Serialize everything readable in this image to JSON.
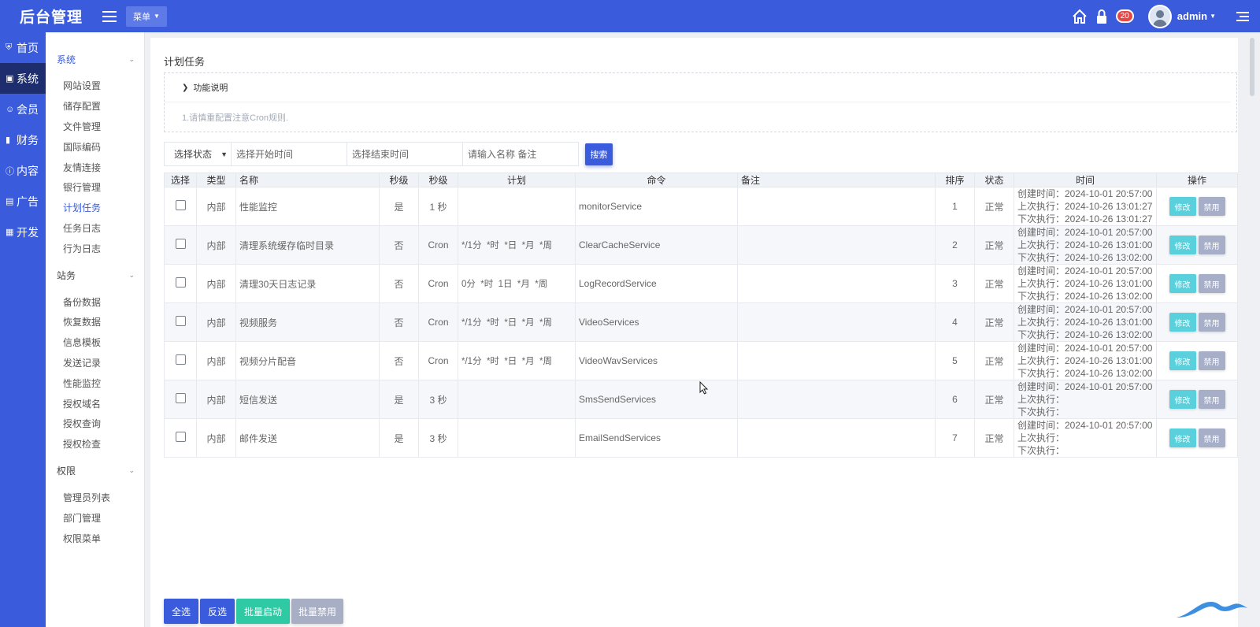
{
  "header": {
    "logo": "后台管理",
    "menu_select": "菜单",
    "badge_count": "20",
    "username": "admin",
    "accent": "#3a5bdc"
  },
  "rail": [
    {
      "icon": "shield-icon",
      "label": "首页"
    },
    {
      "icon": "chat-icon",
      "label": "系统",
      "active": true
    },
    {
      "icon": "user-icon",
      "label": "会员"
    },
    {
      "icon": "chart-icon",
      "label": "财务"
    },
    {
      "icon": "info-icon",
      "label": "内容"
    },
    {
      "icon": "monitor-icon",
      "label": "广告"
    },
    {
      "icon": "code-icon",
      "label": "开发"
    }
  ],
  "submenu": [
    {
      "title": "系统",
      "active": true,
      "items": [
        "网站设置",
        "储存配置",
        "文件管理",
        "国际编码",
        "友情连接",
        "银行管理",
        "计划任务",
        "任务日志",
        "行为日志"
      ],
      "active_item": "计划任务"
    },
    {
      "title": "站务",
      "items": [
        "备份数据",
        "恢复数据",
        "信息模板",
        "发送记录",
        "性能监控",
        "授权域名",
        "授权查询",
        "授权检查"
      ]
    },
    {
      "title": "权限",
      "items": [
        "管理员列表",
        "部门管理",
        "权限菜单"
      ]
    }
  ],
  "page": {
    "title": "计划任务",
    "notice_title": "功能说明",
    "notice_text": "1.请慎重配置注意Cron规则."
  },
  "filters": {
    "status": "选择状态",
    "start_placeholder": "选择开始时间",
    "end_placeholder": "选择结束时间",
    "keyword_placeholder": "请输入名称 备注",
    "search_label": "搜索"
  },
  "table": {
    "headers": [
      "选择",
      "类型",
      "名称",
      "秒级",
      "秒级",
      "计划",
      "命令",
      "备注",
      "排序",
      "状态",
      "时间",
      "操作"
    ],
    "edit_label": "修改",
    "disable_label": "禁用",
    "rows": [
      {
        "type": "内部",
        "name": "性能监控",
        "sec": "是",
        "sec2": "1 秒",
        "plan": "",
        "cmd": "monitorService",
        "note": "",
        "sort": "1",
        "status": "正常",
        "t1": "创建时间：2024-10-01 20:57:00",
        "t2": "上次执行：2024-10-26 13:01:27",
        "t3": "下次执行：2024-10-26 13:01:27"
      },
      {
        "type": "内部",
        "name": "清理系统缓存临时目录",
        "sec": "否",
        "sec2": "Cron",
        "plan": "*/1分  *时  *日  *月  *周",
        "cmd": "ClearCacheService",
        "note": "",
        "sort": "2",
        "status": "正常",
        "t1": "创建时间：2024-10-01 20:57:00",
        "t2": "上次执行：2024-10-26 13:01:00",
        "t3": "下次执行：2024-10-26 13:02:00"
      },
      {
        "type": "内部",
        "name": "清理30天日志记录",
        "sec": "否",
        "sec2": "Cron",
        "plan": "0分  *时  1日  *月  *周",
        "cmd": "LogRecordService",
        "note": "",
        "sort": "3",
        "status": "正常",
        "t1": "创建时间：2024-10-01 20:57:00",
        "t2": "上次执行：2024-10-26 13:01:00",
        "t3": "下次执行：2024-10-26 13:02:00"
      },
      {
        "type": "内部",
        "name": "视频服务",
        "sec": "否",
        "sec2": "Cron",
        "plan": "*/1分  *时  *日  *月  *周",
        "cmd": "VideoServices",
        "note": "",
        "sort": "4",
        "status": "正常",
        "t1": "创建时间：2024-10-01 20:57:00",
        "t2": "上次执行：2024-10-26 13:01:00",
        "t3": "下次执行：2024-10-26 13:02:00"
      },
      {
        "type": "内部",
        "name": "视频分片配音",
        "sec": "否",
        "sec2": "Cron",
        "plan": "*/1分  *时  *日  *月  *周",
        "cmd": "VideoWavServices",
        "note": "",
        "sort": "5",
        "status": "正常",
        "t1": "创建时间：2024-10-01 20:57:00",
        "t2": "上次执行：2024-10-26 13:01:00",
        "t3": "下次执行：2024-10-26 13:02:00"
      },
      {
        "type": "内部",
        "name": "短信发送",
        "sec": "是",
        "sec2": "3 秒",
        "plan": "",
        "cmd": "SmsSendServices",
        "note": "",
        "sort": "6",
        "status": "正常",
        "t1": "创建时间：2024-10-01 20:57:00",
        "t2": "上次执行：",
        "t3": "下次执行："
      },
      {
        "type": "内部",
        "name": "邮件发送",
        "sec": "是",
        "sec2": "3 秒",
        "plan": "",
        "cmd": "EmailSendServices",
        "note": "",
        "sort": "7",
        "status": "正常",
        "t1": "创建时间：2024-10-01 20:57:00",
        "t2": "上次执行：",
        "t3": "下次执行："
      }
    ]
  },
  "bottom": {
    "select_all": "全选",
    "invert": "反选",
    "batch_enable": "批量启动",
    "batch_disable": "批量禁用"
  }
}
